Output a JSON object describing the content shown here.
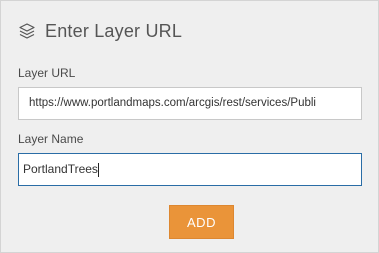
{
  "header": {
    "title": "Enter Layer URL",
    "icon": "layers-icon"
  },
  "form": {
    "url_label": "Layer URL",
    "url_value": "https://www.portlandmaps.com/arcgis/rest/services/Publi",
    "name_label": "Layer Name",
    "name_value": "PortlandTrees"
  },
  "actions": {
    "add_label": "ADD"
  },
  "colors": {
    "accent": "#ea9439",
    "focus_border": "#2a6da6",
    "background": "#efefef"
  }
}
